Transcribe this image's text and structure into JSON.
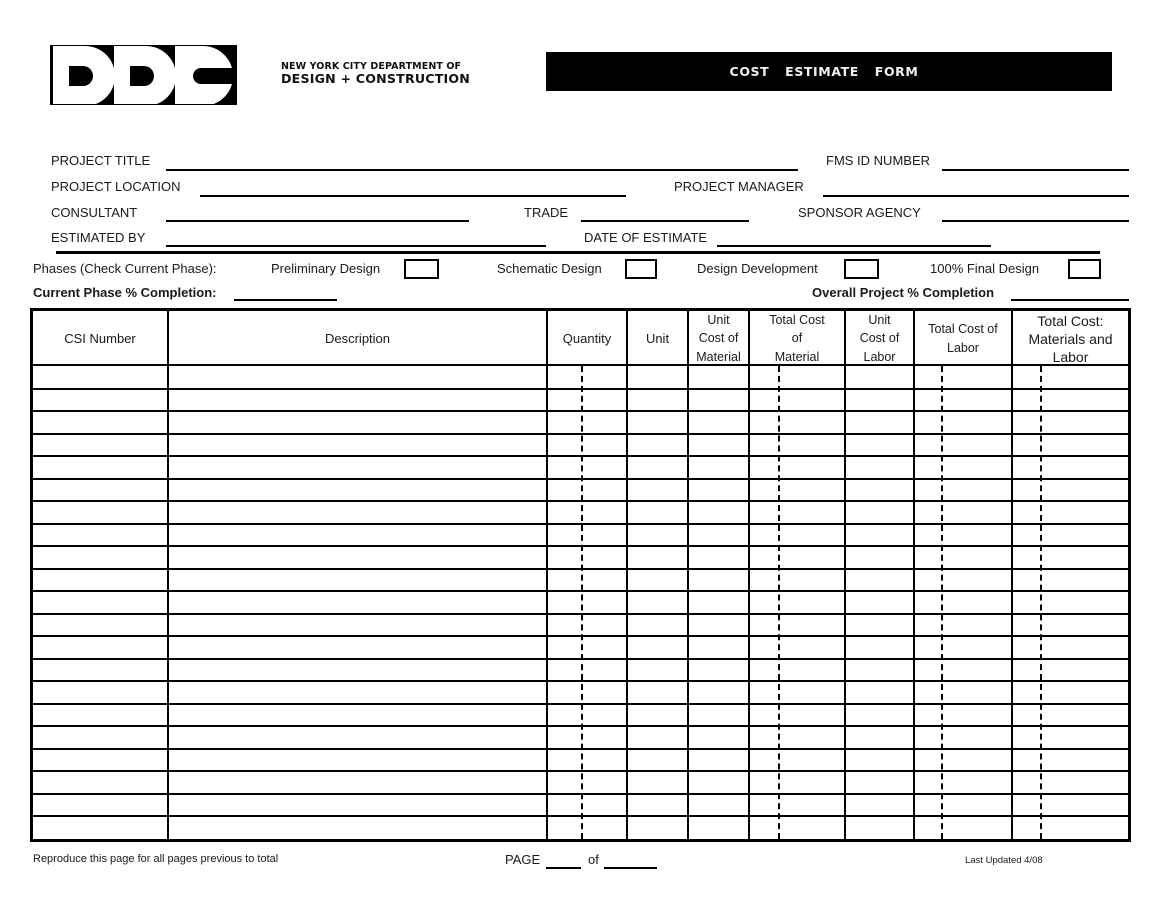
{
  "header": {
    "logo_text": "DDC",
    "agency_line1": "NEW YORK CITY DEPARTMENT OF",
    "agency_line2": "DESIGN + CONSTRUCTION",
    "form_title": "COST  ESTIMATE  FORM"
  },
  "fields": {
    "project_title": {
      "label": "PROJECT TITLE",
      "value": ""
    },
    "fms_id_number": {
      "label": "FMS ID NUMBER",
      "value": ""
    },
    "project_location": {
      "label": "PROJECT LOCATION",
      "value": ""
    },
    "project_manager": {
      "label": "PROJECT MANAGER",
      "value": ""
    },
    "consultant": {
      "label": "CONSULTANT",
      "value": ""
    },
    "trade": {
      "label": "TRADE",
      "value": ""
    },
    "sponsor_agency": {
      "label": "SPONSOR AGENCY",
      "value": ""
    },
    "estimated_by": {
      "label": "ESTIMATED BY",
      "value": ""
    },
    "date_of_estimate": {
      "label": "DATE OF ESTIMATE",
      "value": ""
    }
  },
  "phases": {
    "label": "Phases (Check Current Phase):",
    "options": [
      {
        "label": "Preliminary Design",
        "checked": false
      },
      {
        "label": "Schematic Design",
        "checked": false
      },
      {
        "label": "Design Development",
        "checked": false
      },
      {
        "label": "100% Final Design",
        "checked": false
      }
    ]
  },
  "completion": {
    "current_phase_label": "Current Phase % Completion:",
    "current_phase_value": "",
    "overall_label": "Overall Project % Completion",
    "overall_value": ""
  },
  "table": {
    "columns": [
      {
        "key": "csi_number",
        "label": "CSI Number"
      },
      {
        "key": "description",
        "label": "Description"
      },
      {
        "key": "quantity",
        "label": "Quantity"
      },
      {
        "key": "unit",
        "label": "Unit"
      },
      {
        "key": "unit_cost_material",
        "label": "Unit Cost of Material"
      },
      {
        "key": "total_cost_material",
        "label": "Total Cost of Material"
      },
      {
        "key": "unit_cost_labor",
        "label": "Unit Cost of Labor"
      },
      {
        "key": "total_cost_labor",
        "label": "Total Cost of Labor"
      },
      {
        "key": "total_cost_materials_labor",
        "label": "Total Cost: Materials and Labor"
      }
    ],
    "header_lines": {
      "unit_cost_material": [
        "Unit",
        "Cost of",
        "Material"
      ],
      "total_cost_material": [
        "Total Cost",
        "of",
        "Material"
      ],
      "unit_cost_labor": [
        "Unit",
        "Cost of",
        "Labor"
      ],
      "total_cost_labor": [
        "Total Cost of",
        "Labor"
      ],
      "total_cost_materials_labor": [
        "Total Cost:",
        "Materials and",
        "Labor"
      ]
    },
    "rows": [
      [
        "",
        "",
        "",
        "",
        "",
        "",
        "",
        "",
        ""
      ],
      [
        "",
        "",
        "",
        "",
        "",
        "",
        "",
        "",
        ""
      ],
      [
        "",
        "",
        "",
        "",
        "",
        "",
        "",
        "",
        ""
      ],
      [
        "",
        "",
        "",
        "",
        "",
        "",
        "",
        "",
        ""
      ],
      [
        "",
        "",
        "",
        "",
        "",
        "",
        "",
        "",
        ""
      ],
      [
        "",
        "",
        "",
        "",
        "",
        "",
        "",
        "",
        ""
      ],
      [
        "",
        "",
        "",
        "",
        "",
        "",
        "",
        "",
        ""
      ],
      [
        "",
        "",
        "",
        "",
        "",
        "",
        "",
        "",
        ""
      ],
      [
        "",
        "",
        "",
        "",
        "",
        "",
        "",
        "",
        ""
      ],
      [
        "",
        "",
        "",
        "",
        "",
        "",
        "",
        "",
        ""
      ],
      [
        "",
        "",
        "",
        "",
        "",
        "",
        "",
        "",
        ""
      ],
      [
        "",
        "",
        "",
        "",
        "",
        "",
        "",
        "",
        ""
      ],
      [
        "",
        "",
        "",
        "",
        "",
        "",
        "",
        "",
        ""
      ],
      [
        "",
        "",
        "",
        "",
        "",
        "",
        "",
        "",
        ""
      ],
      [
        "",
        "",
        "",
        "",
        "",
        "",
        "",
        "",
        ""
      ],
      [
        "",
        "",
        "",
        "",
        "",
        "",
        "",
        "",
        ""
      ],
      [
        "",
        "",
        "",
        "",
        "",
        "",
        "",
        "",
        ""
      ],
      [
        "",
        "",
        "",
        "",
        "",
        "",
        "",
        "",
        ""
      ],
      [
        "",
        "",
        "",
        "",
        "",
        "",
        "",
        "",
        ""
      ],
      [
        "",
        "",
        "",
        "",
        "",
        "",
        "",
        "",
        ""
      ],
      [
        "",
        "",
        "",
        "",
        "",
        "",
        "",
        "",
        ""
      ]
    ]
  },
  "footer": {
    "note": "Reproduce this page for all pages previous to total",
    "page_label": "PAGE",
    "page_value": "",
    "of_label": "of",
    "of_value": "",
    "last_updated": "Last Updated  4/08"
  },
  "colors": {
    "ink": "#000000",
    "text": "#1a1a1a",
    "title_bar_bg": "#000000",
    "title_bar_text": "#f2f2f2",
    "paper": "#ffffff"
  }
}
